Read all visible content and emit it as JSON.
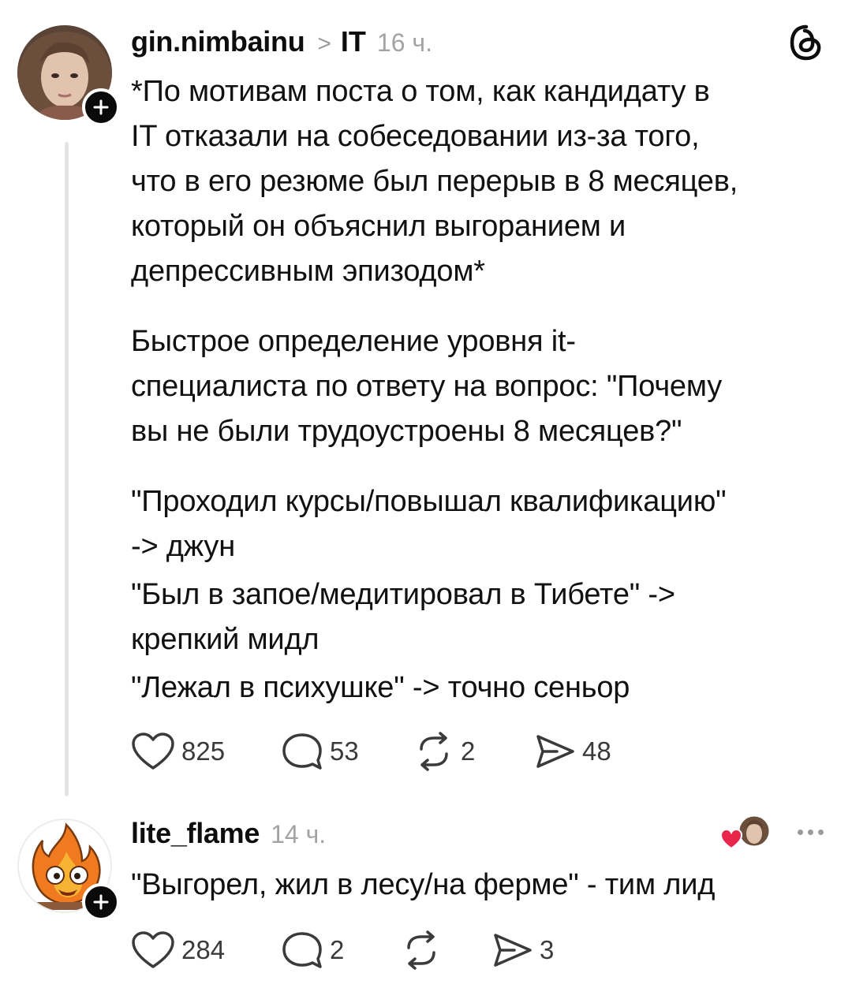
{
  "post": {
    "username": "gin.nimbainu",
    "crumb_separator": ">",
    "topic": "IT",
    "time": "16 ч.",
    "paragraphs": [
      [
        "*По мотивам поста о том, как кандидату в",
        "IT отказали на собеседовании из-за того,",
        "что в его резюме был перерыв в 8 месяцев,",
        "который он объяснил выгоранием и",
        "депрессивным эпизодом*"
      ],
      [
        "Быстрое определение уровня it-",
        "специалиста по ответу на вопрос: \"Почему",
        "вы не были трудоустроены 8 месяцев?\""
      ],
      [
        "\"Проходил курсы/повышал квалификацию\"",
        "-> джун",
        "\"Был в запое/медитировал в Тибете\" ->",
        "крепкий мидл",
        "\"Лежал в психушке\" -> точно сеньор"
      ]
    ],
    "stats": {
      "likes": "825",
      "comments": "53",
      "reposts": "2",
      "shares": "48"
    }
  },
  "reply": {
    "username": "lite_flame",
    "time": "14 ч.",
    "text": "\"Выгорел, жил в лесу/на ферме\" - тим лид",
    "stats": {
      "likes": "284",
      "comments": "2",
      "reposts": "",
      "shares": "3"
    }
  },
  "icons": {
    "app_logo": "threads-logo-icon",
    "follow": "plus-icon",
    "like": "heart-icon",
    "comment": "comment-bubble-icon",
    "repost": "repost-icon",
    "share": "send-icon",
    "more": "more-dots-icon",
    "liked_by_author": "heart-icon"
  },
  "colors": {
    "text": "#111111",
    "secondary": "#a3a3a3",
    "icon": "#3a3a3a",
    "like_heart": "#e8264b"
  }
}
